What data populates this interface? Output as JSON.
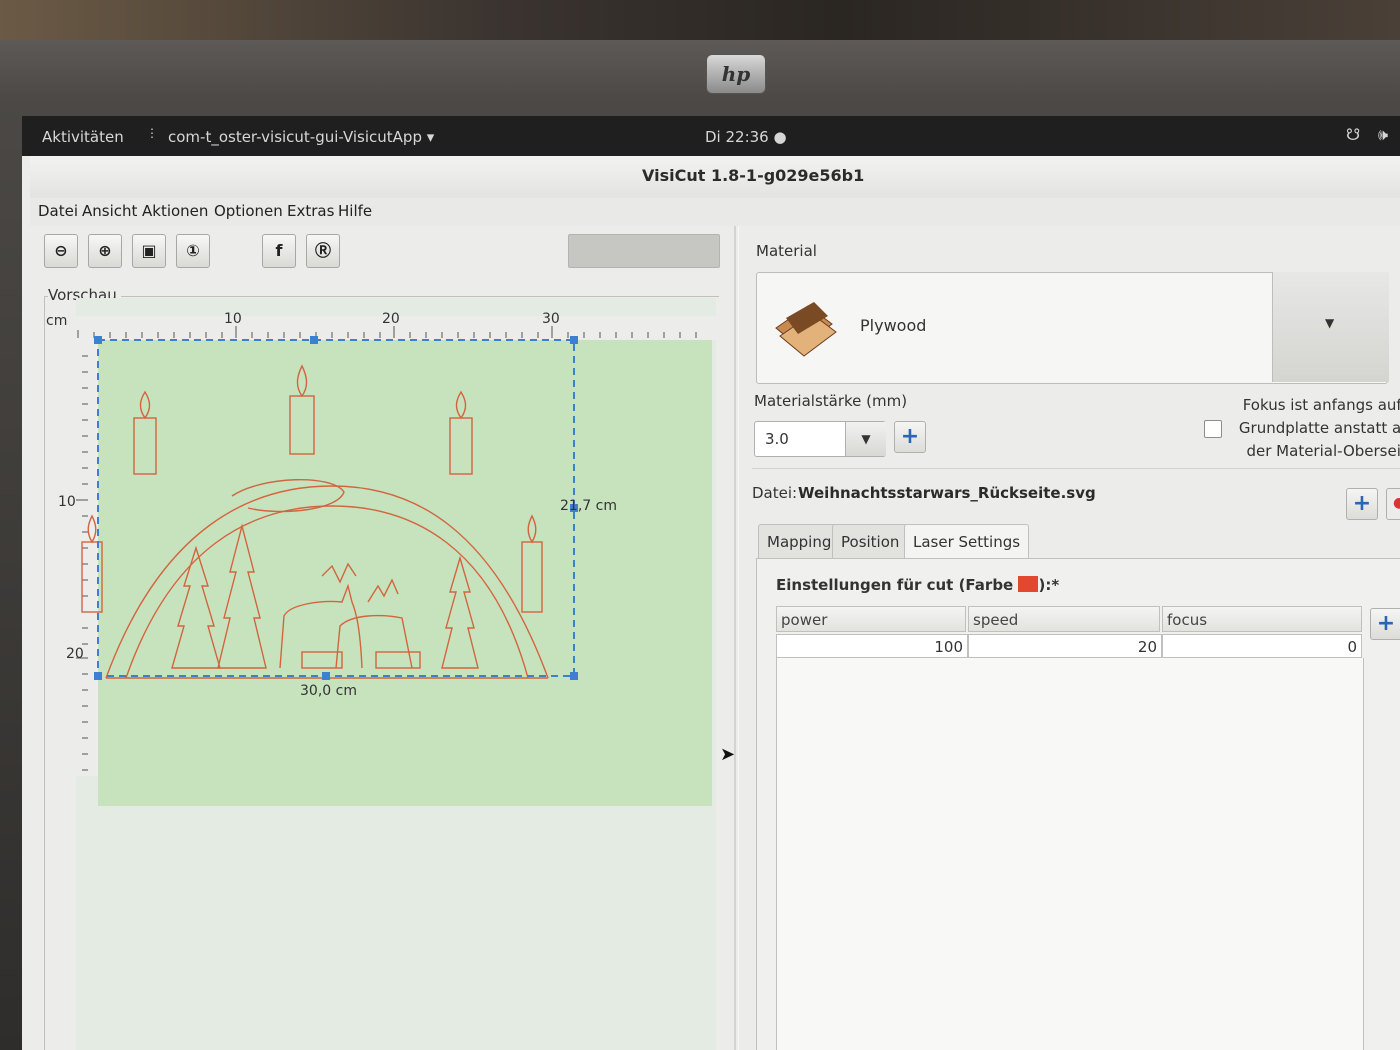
{
  "topbar": {
    "activities": "Aktivitäten",
    "app_menu": "com-t_oster-visicut-gui-VisicutApp ▾",
    "clock": "Di 22:36 ●"
  },
  "window": {
    "title": "VisiCut 1.8-1-g029e56b1"
  },
  "menu": [
    "Datei",
    "Ansicht",
    "Aktionen",
    "Optionen",
    "Extras",
    "Hilfe"
  ],
  "preview": {
    "label": "Vorschau",
    "unit": "cm",
    "ruler_top": [
      "10",
      "20",
      "30"
    ],
    "ruler_left": [
      "10",
      "20"
    ],
    "width_label": "30,0 cm",
    "height_label": "21,7 cm"
  },
  "material": {
    "section_label": "Material",
    "name": "Plywood",
    "thickness_label": "Materialstärke (mm)",
    "thickness_value": "3.0",
    "focus_text": [
      "Fokus ist anfangs auf d",
      "Grundplatte anstatt auf",
      "der Material-Oberseite"
    ]
  },
  "file": {
    "label": "Datei:",
    "name": "Weihnachtsstarwars_Rückseite.svg"
  },
  "tabs": [
    "Mapping",
    "Position",
    "Laser Settings"
  ],
  "settings": {
    "heading_prefix": "Einstellungen für cut (Farbe ",
    "heading_suffix": "):*",
    "color": "#e2472f",
    "columns": [
      "power",
      "speed",
      "focus"
    ],
    "row": [
      "100",
      "20",
      "0"
    ]
  },
  "colors": {
    "bed": "#c6e3bd",
    "cut_lines": "#d2653f",
    "selection": "#3d7fd1"
  }
}
